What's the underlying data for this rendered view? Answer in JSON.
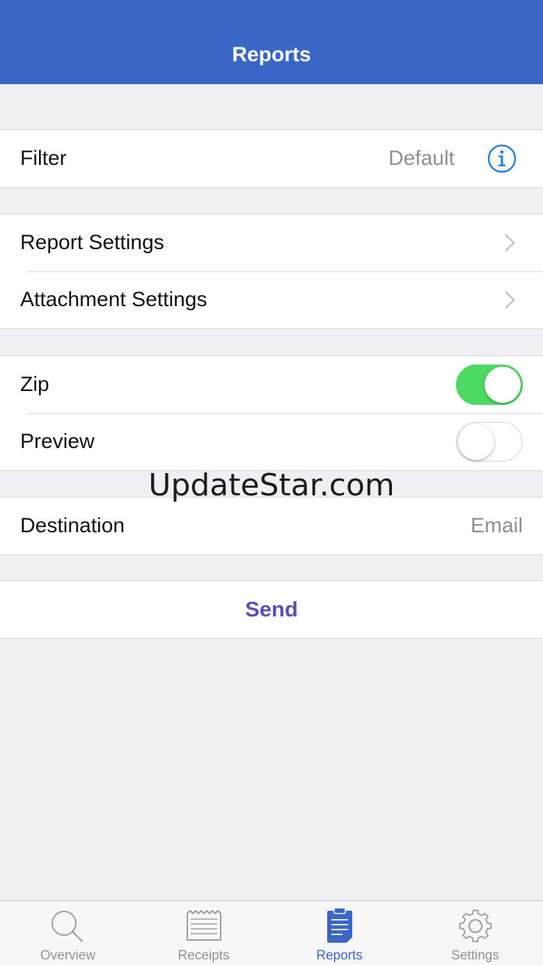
{
  "navbar": {
    "title": "Reports"
  },
  "filter": {
    "label": "Filter",
    "value": "Default",
    "icon": "info-icon"
  },
  "settings": {
    "report_label": "Report Settings",
    "attachment_label": "Attachment Settings"
  },
  "options": {
    "zip": {
      "label": "Zip",
      "on": true
    },
    "preview": {
      "label": "Preview",
      "on": false
    }
  },
  "destination": {
    "label": "Destination",
    "value": "Email"
  },
  "send": {
    "label": "Send"
  },
  "watermark": "UpdateStar.com",
  "tabs": [
    {
      "label": "Overview",
      "icon": "search-icon",
      "active": false
    },
    {
      "label": "Receipts",
      "icon": "receipt-icon",
      "active": false
    },
    {
      "label": "Reports",
      "icon": "report-clipboard-icon",
      "active": true
    },
    {
      "label": "Settings",
      "icon": "gear-icon",
      "active": false
    }
  ],
  "colors": {
    "accent": "#3a66c8",
    "toggle_on": "#4cd964",
    "send": "#5a4fb4",
    "info": "#1e7ee6"
  }
}
